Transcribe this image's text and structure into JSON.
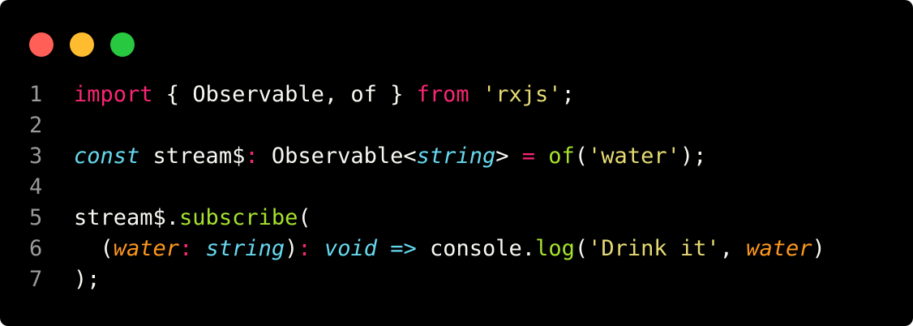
{
  "window_controls": {
    "close_color": "#ff5f57",
    "minimize_color": "#febc2e",
    "maximize_color": "#28c840"
  },
  "colors": {
    "background": "#000000",
    "line_number": "#9a9a9a",
    "default": "#f8f8f2",
    "keyword": "#f92672",
    "string": "#e6db74",
    "storage": "#66d9ef",
    "function": "#a6e22e",
    "parameter": "#fd971f"
  },
  "code": {
    "lines": [
      {
        "number": "1",
        "tokens": [
          {
            "text": "import",
            "role": "keyword"
          },
          {
            "text": " { Observable, of } ",
            "role": "default"
          },
          {
            "text": "from",
            "role": "keyword"
          },
          {
            "text": " ",
            "role": "default"
          },
          {
            "text": "'rxjs'",
            "role": "string"
          },
          {
            "text": ";",
            "role": "default"
          }
        ]
      },
      {
        "number": "2",
        "tokens": []
      },
      {
        "number": "3",
        "tokens": [
          {
            "text": "const",
            "role": "storage",
            "italic": true
          },
          {
            "text": " stream$",
            "role": "default"
          },
          {
            "text": ":",
            "role": "keyword"
          },
          {
            "text": " Observable<",
            "role": "default"
          },
          {
            "text": "string",
            "role": "storage",
            "italic": true
          },
          {
            "text": "> ",
            "role": "default"
          },
          {
            "text": "=",
            "role": "keyword"
          },
          {
            "text": " ",
            "role": "default"
          },
          {
            "text": "of",
            "role": "function"
          },
          {
            "text": "(",
            "role": "default"
          },
          {
            "text": "'water'",
            "role": "string"
          },
          {
            "text": ");",
            "role": "default"
          }
        ]
      },
      {
        "number": "4",
        "tokens": []
      },
      {
        "number": "5",
        "tokens": [
          {
            "text": "stream$.",
            "role": "default"
          },
          {
            "text": "subscribe",
            "role": "function"
          },
          {
            "text": "(",
            "role": "default"
          }
        ]
      },
      {
        "number": "6",
        "tokens": [
          {
            "text": "  (",
            "role": "default"
          },
          {
            "text": "water",
            "role": "parameter",
            "italic": true
          },
          {
            "text": ":",
            "role": "keyword"
          },
          {
            "text": " ",
            "role": "default"
          },
          {
            "text": "string",
            "role": "storage",
            "italic": true
          },
          {
            "text": ")",
            "role": "default"
          },
          {
            "text": ":",
            "role": "keyword"
          },
          {
            "text": " ",
            "role": "default"
          },
          {
            "text": "void",
            "role": "storage",
            "italic": true
          },
          {
            "text": " ",
            "role": "default"
          },
          {
            "text": "=>",
            "role": "storage",
            "italic": true
          },
          {
            "text": " console.",
            "role": "default"
          },
          {
            "text": "log",
            "role": "function"
          },
          {
            "text": "(",
            "role": "default"
          },
          {
            "text": "'Drink it'",
            "role": "string"
          },
          {
            "text": ", ",
            "role": "default"
          },
          {
            "text": "water",
            "role": "parameter",
            "italic": true
          },
          {
            "text": ")",
            "role": "default"
          }
        ]
      },
      {
        "number": "7",
        "tokens": [
          {
            "text": ");",
            "role": "default"
          }
        ]
      }
    ]
  }
}
